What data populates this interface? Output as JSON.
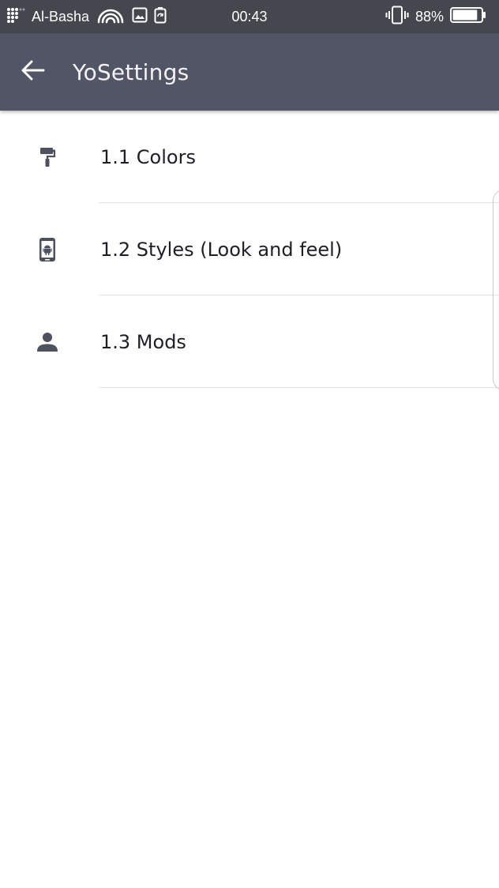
{
  "status_bar": {
    "carrier": "Al-Basha",
    "time": "00:43",
    "battery": "88%",
    "battery_level": 0.88,
    "icons": [
      "signal-icon",
      "wifi-icon",
      "image-notification-icon",
      "battery-saver-icon",
      "vibrate-icon",
      "battery-icon"
    ]
  },
  "app_bar": {
    "title": "YoSettings",
    "back_icon": "arrow-left-icon",
    "colors": {
      "status_bar": "#45474f",
      "toolbar": "#525565"
    }
  },
  "items": [
    {
      "label": "1.1 Colors",
      "icon": "paint-roller-icon"
    },
    {
      "label": "1.2 Styles (Look and feel)",
      "icon": "android-phone-icon"
    },
    {
      "label": "1.3 Mods",
      "icon": "person-icon"
    }
  ]
}
